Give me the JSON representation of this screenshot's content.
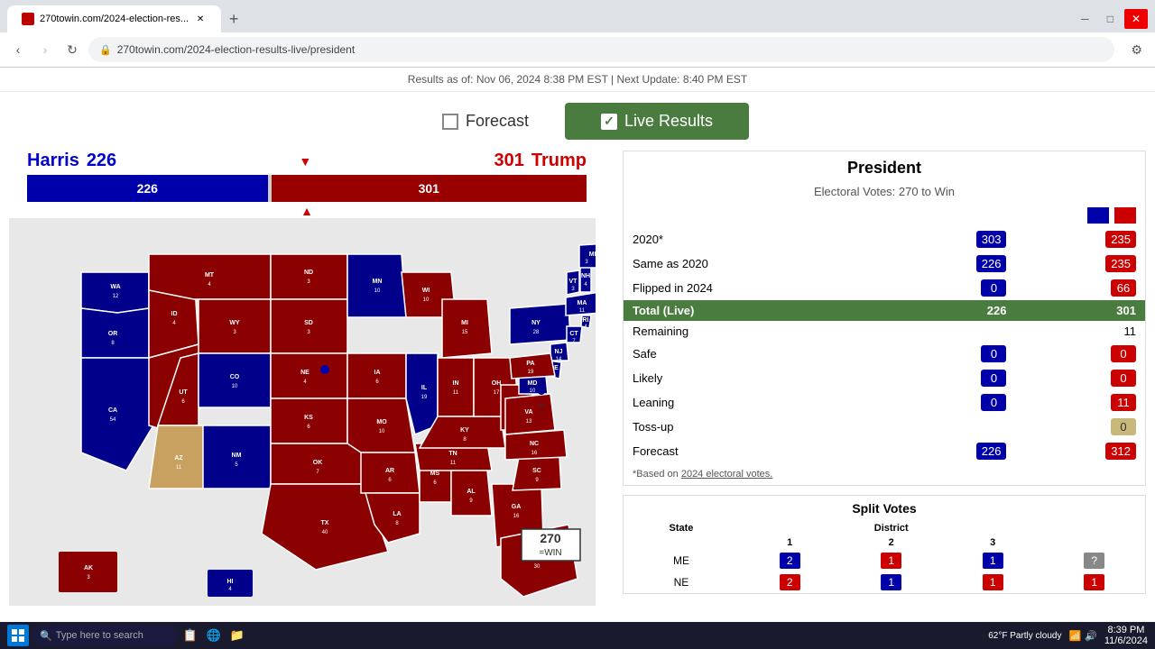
{
  "browser": {
    "tab_label": "270towin.com/2024-election-results-live/president",
    "url": "270towin.com/2024-election-results-live/president"
  },
  "status_bar": {
    "text": "Results as of: Nov 06, 2024 8:38 PM EST | Next Update: 8:40 PM EST"
  },
  "toggle": {
    "forecast_label": "Forecast",
    "live_label": "Live Results"
  },
  "electoral": {
    "harris_name": "Harris",
    "harris_ev": "226",
    "trump_name": "Trump",
    "trump_ev": "301",
    "bar_blue": "226",
    "bar_red": "301"
  },
  "president": {
    "title": "President",
    "subtitle": "Electoral Votes: 270 to Win",
    "rows": [
      {
        "label": "2020*",
        "blue": "303",
        "red": "235"
      },
      {
        "label": "Same as 2020",
        "blue": "226",
        "red": "235"
      },
      {
        "label": "Flipped in 2024",
        "blue": "0",
        "red": "66"
      },
      {
        "label": "Total (Live)",
        "blue": "226",
        "red": "301",
        "highlight": true
      },
      {
        "label": "Remaining",
        "value": "11"
      },
      {
        "label": "Safe",
        "blue": "0",
        "red": "0"
      },
      {
        "label": "Likely",
        "blue": "0",
        "red": "0"
      },
      {
        "label": "Leaning",
        "blue": "0",
        "red": "11"
      },
      {
        "label": "Toss-up",
        "tan": "0"
      },
      {
        "label": "Forecast",
        "blue": "226",
        "red": "312"
      }
    ],
    "footnote": "*Based on 2024 electoral votes."
  },
  "split_votes": {
    "title": "Split Votes",
    "col_state": "State",
    "col_d1": "1",
    "col_d2": "2",
    "col_d3": "3",
    "col_header": "District",
    "rows": [
      {
        "state": "ME",
        "vals": [
          "2",
          "1",
          "1",
          "?"
        ]
      },
      {
        "state": "NE",
        "vals": [
          "2",
          "1",
          "1",
          "1"
        ]
      }
    ]
  },
  "win_badge": {
    "number": "270",
    "text": "=WIN"
  },
  "taskbar": {
    "time": "8:39 PM",
    "date": "11/6/2024",
    "weather": "62°F Partly cloudy"
  }
}
